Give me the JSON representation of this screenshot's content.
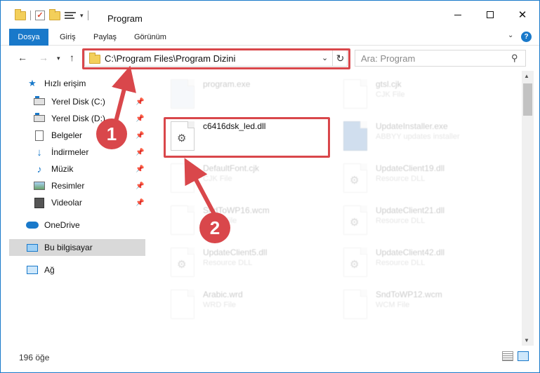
{
  "window": {
    "title": "Program",
    "controls": {
      "minimize": "─",
      "maximize": "□",
      "close": "✕"
    }
  },
  "ribbon": {
    "tabs": [
      "Dosya",
      "Giriş",
      "Paylaş",
      "Görünüm"
    ],
    "help": "?"
  },
  "nav": {
    "address": "C:\\Program Files\\Program Dizini",
    "search_placeholder": "Ara: Program"
  },
  "sidebar": {
    "items": [
      {
        "label": "Hızlı erişim",
        "icon": "star-icon"
      },
      {
        "label": "Yerel Disk (C:)",
        "icon": "disk-icon",
        "pinned": true
      },
      {
        "label": "Yerel Disk (D:)",
        "icon": "disk-icon",
        "pinned": true
      },
      {
        "label": "Belgeler",
        "icon": "document-icon",
        "pinned": true
      },
      {
        "label": "İndirmeler",
        "icon": "download-icon",
        "pinned": true
      },
      {
        "label": "Müzik",
        "icon": "music-icon",
        "pinned": true
      },
      {
        "label": "Resimler",
        "icon": "pictures-icon",
        "pinned": true
      },
      {
        "label": "Videolar",
        "icon": "video-icon",
        "pinned": true
      },
      {
        "label": "OneDrive",
        "icon": "cloud-icon"
      },
      {
        "label": "Bu bilgisayar",
        "icon": "computer-icon",
        "selected": true
      },
      {
        "label": "Ağ",
        "icon": "network-icon"
      }
    ]
  },
  "files": [
    {
      "name": "program.exe",
      "type": "",
      "highlighted": false
    },
    {
      "name": "gtsl.cjk",
      "type": "CJK File",
      "highlighted": false
    },
    {
      "name": "c6416dsk_led.dll",
      "type": "",
      "highlighted": true
    },
    {
      "name": "UpdateInstaller.exe",
      "type": "ABBYY updates installer",
      "highlighted": false
    },
    {
      "name": "DefaultFont.cjk",
      "type": "CJK File",
      "highlighted": false
    },
    {
      "name": "UpdateClient19.dll",
      "type": "Resource DLL",
      "highlighted": false
    },
    {
      "name": "SndToWP16.wcm",
      "type": "WCM File",
      "highlighted": false
    },
    {
      "name": "UpdateClient21.dll",
      "type": "Resource DLL",
      "highlighted": false
    },
    {
      "name": "UpdateClient5.dll",
      "type": "Resource DLL",
      "highlighted": false
    },
    {
      "name": "UpdateClient42.dll",
      "type": "Resource DLL",
      "highlighted": false
    },
    {
      "name": "Arabic.wrd",
      "type": "WRD File",
      "highlighted": false
    },
    {
      "name": "SndToWP12.wcm",
      "type": "WCM File",
      "highlighted": false
    }
  ],
  "status": {
    "count": "196 öğe"
  },
  "annotations": {
    "step1": "1",
    "step2": "2",
    "color": "#d9474b"
  }
}
